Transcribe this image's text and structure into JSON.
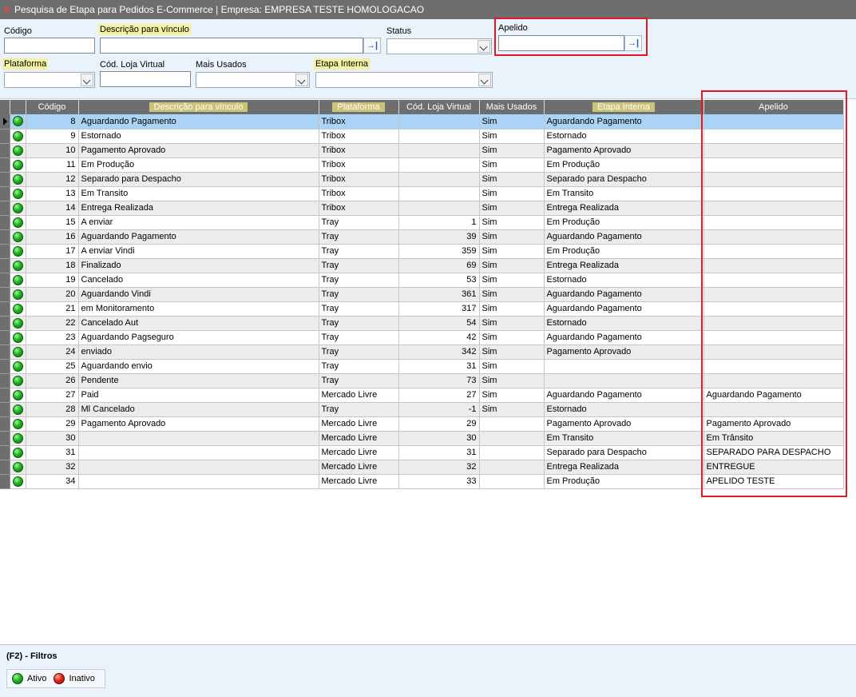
{
  "window": {
    "title": "Pesquisa de Etapa para Pedidos E-Commerce | Empresa: EMPRESA TESTE HOMOLOGACAO"
  },
  "filters": {
    "codigo_label": "Código",
    "descricao_label": "Descrição para vínculo",
    "status_label": "Status",
    "apelido_label": "Apelido",
    "plataforma_label": "Plataforma",
    "cod_loja_label": "Cód. Loja Virtual",
    "mais_usados_label": "Mais Usados",
    "etapa_interna_label": "Etapa Interna",
    "go_icon_glyph": "→|"
  },
  "grid": {
    "columns": {
      "codigo": "Código",
      "descricao": "Descrição para vínculo",
      "plataforma": "Plataforma",
      "cod_loja": "Cód. Loja Virtual",
      "mais_usados": "Mais Usados",
      "etapa_interna": "Etapa Interna",
      "apelido": "Apelido"
    },
    "rows": [
      {
        "codigo": "8",
        "descricao": "Aguardando Pagamento",
        "plataforma": "Tribox",
        "cod_loja": "",
        "mais_usados": "Sim",
        "etapa": "Aguardando Pagamento",
        "apelido": ""
      },
      {
        "codigo": "9",
        "descricao": "Estornado",
        "plataforma": "Tribox",
        "cod_loja": "",
        "mais_usados": "Sim",
        "etapa": "Estornado",
        "apelido": ""
      },
      {
        "codigo": "10",
        "descricao": "Pagamento Aprovado",
        "plataforma": "Tribox",
        "cod_loja": "",
        "mais_usados": "Sim",
        "etapa": "Pagamento Aprovado",
        "apelido": ""
      },
      {
        "codigo": "11",
        "descricao": "Em Produção",
        "plataforma": "Tribox",
        "cod_loja": "",
        "mais_usados": "Sim",
        "etapa": "Em Produção",
        "apelido": ""
      },
      {
        "codigo": "12",
        "descricao": "Separado para Despacho",
        "plataforma": "Tribox",
        "cod_loja": "",
        "mais_usados": "Sim",
        "etapa": "Separado para Despacho",
        "apelido": ""
      },
      {
        "codigo": "13",
        "descricao": "Em Transito",
        "plataforma": "Tribox",
        "cod_loja": "",
        "mais_usados": "Sim",
        "etapa": "Em Transito",
        "apelido": ""
      },
      {
        "codigo": "14",
        "descricao": "Entrega Realizada",
        "plataforma": "Tribox",
        "cod_loja": "",
        "mais_usados": "Sim",
        "etapa": "Entrega Realizada",
        "apelido": ""
      },
      {
        "codigo": "15",
        "descricao": "A enviar",
        "plataforma": "Tray",
        "cod_loja": "1",
        "mais_usados": "Sim",
        "etapa": "Em Produção",
        "apelido": ""
      },
      {
        "codigo": "16",
        "descricao": "Aguardando Pagamento",
        "plataforma": "Tray",
        "cod_loja": "39",
        "mais_usados": "Sim",
        "etapa": "Aguardando Pagamento",
        "apelido": ""
      },
      {
        "codigo": "17",
        "descricao": "A enviar Vindi",
        "plataforma": "Tray",
        "cod_loja": "359",
        "mais_usados": "Sim",
        "etapa": "Em Produção",
        "apelido": ""
      },
      {
        "codigo": "18",
        "descricao": "Finalizado",
        "plataforma": "Tray",
        "cod_loja": "69",
        "mais_usados": "Sim",
        "etapa": "Entrega Realizada",
        "apelido": ""
      },
      {
        "codigo": "19",
        "descricao": "Cancelado",
        "plataforma": "Tray",
        "cod_loja": "53",
        "mais_usados": "Sim",
        "etapa": "Estornado",
        "apelido": ""
      },
      {
        "codigo": "20",
        "descricao": "Aguardando Vindi",
        "plataforma": "Tray",
        "cod_loja": "361",
        "mais_usados": "Sim",
        "etapa": "Aguardando Pagamento",
        "apelido": ""
      },
      {
        "codigo": "21",
        "descricao": "em Monitoramento",
        "plataforma": "Tray",
        "cod_loja": "317",
        "mais_usados": "Sim",
        "etapa": "Aguardando Pagamento",
        "apelido": ""
      },
      {
        "codigo": "22",
        "descricao": "Cancelado Aut",
        "plataforma": "Tray",
        "cod_loja": "54",
        "mais_usados": "Sim",
        "etapa": "Estornado",
        "apelido": ""
      },
      {
        "codigo": "23",
        "descricao": "Aguardando Pagseguro",
        "plataforma": "Tray",
        "cod_loja": "42",
        "mais_usados": "Sim",
        "etapa": "Aguardando Pagamento",
        "apelido": ""
      },
      {
        "codigo": "24",
        "descricao": "enviado",
        "plataforma": "Tray",
        "cod_loja": "342",
        "mais_usados": "Sim",
        "etapa": "Pagamento Aprovado",
        "apelido": ""
      },
      {
        "codigo": "25",
        "descricao": "Aguardando envio",
        "plataforma": "Tray",
        "cod_loja": "31",
        "mais_usados": "Sim",
        "etapa": "",
        "apelido": ""
      },
      {
        "codigo": "26",
        "descricao": "Pendente",
        "plataforma": "Tray",
        "cod_loja": "73",
        "mais_usados": "Sim",
        "etapa": "",
        "apelido": ""
      },
      {
        "codigo": "27",
        "descricao": "Paid",
        "plataforma": "Mercado Livre",
        "cod_loja": "27",
        "mais_usados": "Sim",
        "etapa": "Aguardando Pagamento",
        "apelido": "Aguardando Pagamento"
      },
      {
        "codigo": "28",
        "descricao": "Ml Cancelado",
        "plataforma": "Tray",
        "cod_loja": "-1",
        "mais_usados": "Sim",
        "etapa": "Estornado",
        "apelido": ""
      },
      {
        "codigo": "29",
        "descricao": "Pagamento Aprovado",
        "plataforma": "Mercado Livre",
        "cod_loja": "29",
        "mais_usados": "",
        "etapa": "Pagamento Aprovado",
        "apelido": "Pagamento Aprovado"
      },
      {
        "codigo": "30",
        "descricao": "",
        "plataforma": "Mercado Livre",
        "cod_loja": "30",
        "mais_usados": "",
        "etapa": "Em Transito",
        "apelido": "Em Trânsito"
      },
      {
        "codigo": "31",
        "descricao": "",
        "plataforma": "Mercado Livre",
        "cod_loja": "31",
        "mais_usados": "",
        "etapa": "Separado para Despacho",
        "apelido": "SEPARADO PARA DESPACHO"
      },
      {
        "codigo": "32",
        "descricao": "",
        "plataforma": "Mercado Livre",
        "cod_loja": "32",
        "mais_usados": "",
        "etapa": "Entrega Realizada",
        "apelido": "ENTREGUE"
      },
      {
        "codigo": "34",
        "descricao": "",
        "plataforma": "Mercado Livre",
        "cod_loja": "33",
        "mais_usados": "",
        "etapa": "Em Produção",
        "apelido": "APELIDO TESTE"
      }
    ]
  },
  "footer": {
    "filters_label": "(F2) - Filtros",
    "ativo_label": "Ativo",
    "inativo_label": "Inativo"
  },
  "colors": {
    "title_bar": "#6e6e6e",
    "panel_bg": "#eaf3fb",
    "highlight_label": "#f3f2a3",
    "selected_row": "#aad3f5",
    "annotation_red": "#e01b24",
    "status_active": "#23b523",
    "status_inactive": "#e3261b"
  },
  "icons": {
    "row_status": "green-ball-icon",
    "go_button": "arrow-to-bar-icon",
    "dropdown": "chevron-down-icon",
    "row_indicator": "triangle-right-icon",
    "window_close": "close-icon"
  }
}
